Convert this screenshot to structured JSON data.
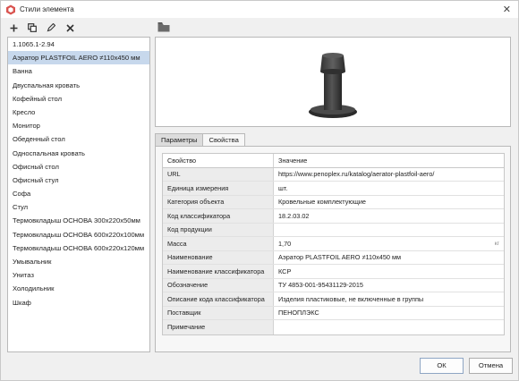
{
  "window": {
    "title": "Стили элемента",
    "close_glyph": "✕"
  },
  "toolbar": {
    "buttons": [
      {
        "name": "add-icon",
        "glyph": "+"
      },
      {
        "name": "copy-icon",
        "glyph": "⧉"
      },
      {
        "name": "edit-icon",
        "glyph": "✎"
      },
      {
        "name": "delete-icon",
        "glyph": "✕"
      }
    ]
  },
  "list": {
    "items": [
      "1.1065.1-2.94",
      "Аэратор PLASTFOIL AERO ≠110x450 мм",
      "Ванна",
      "Двуспальная кровать",
      "Кофейный стол",
      "Кресло",
      "Монитор",
      "Обеденный стол",
      "Односпальная кровать",
      "Офисный стол",
      "Офисный стул",
      "Софа",
      "Стул",
      "Термовкладыш ОСНОВА 300x220x50мм",
      "Термовкладыш ОСНОВА 600x220x100мм",
      "Термовкладыш ОСНОВА 600x220x120мм",
      "Умывальник",
      "Унитаз",
      "Холодильник",
      "Шкаф"
    ],
    "selected_index": 1
  },
  "tabs": [
    {
      "label": "Параметры",
      "active": false
    },
    {
      "label": "Свойства",
      "active": true
    }
  ],
  "properties": {
    "header": {
      "name": "Свойство",
      "value": "Значение"
    },
    "rows": [
      {
        "name": "URL",
        "value": "https://www.penoplex.ru/katalog/aerator-plastfoil-aero/",
        "unit": ""
      },
      {
        "name": "Единица измерения",
        "value": "шт.",
        "unit": ""
      },
      {
        "name": "Категория объекта",
        "value": "Кровельные комплектующие",
        "unit": ""
      },
      {
        "name": "Код классификатора",
        "value": "18.2.03.02",
        "unit": ""
      },
      {
        "name": "Код продукции",
        "value": "",
        "unit": ""
      },
      {
        "name": "Масса",
        "value": "1,70",
        "unit": "кг"
      },
      {
        "name": "Наименование",
        "value": "Аэратор PLASTFOIL AERO ≠110x450 мм",
        "unit": ""
      },
      {
        "name": "Наименование классификатора",
        "value": "КСР",
        "unit": ""
      },
      {
        "name": "Обозначение",
        "value": "ТУ 4853-001-95431129-2015",
        "unit": ""
      },
      {
        "name": "Описание кода классификатора",
        "value": "Изделия пластиковые, не включенные в группы",
        "unit": ""
      },
      {
        "name": "Поставщик",
        "value": "ПЕНОПЛЭКС",
        "unit": ""
      },
      {
        "name": "Примечание",
        "value": "",
        "unit": ""
      }
    ]
  },
  "buttons": {
    "ok": "ОК",
    "cancel": "Отмена"
  },
  "colors": {
    "selection": "#c7d8ec",
    "app_icon": "#d9534f"
  }
}
